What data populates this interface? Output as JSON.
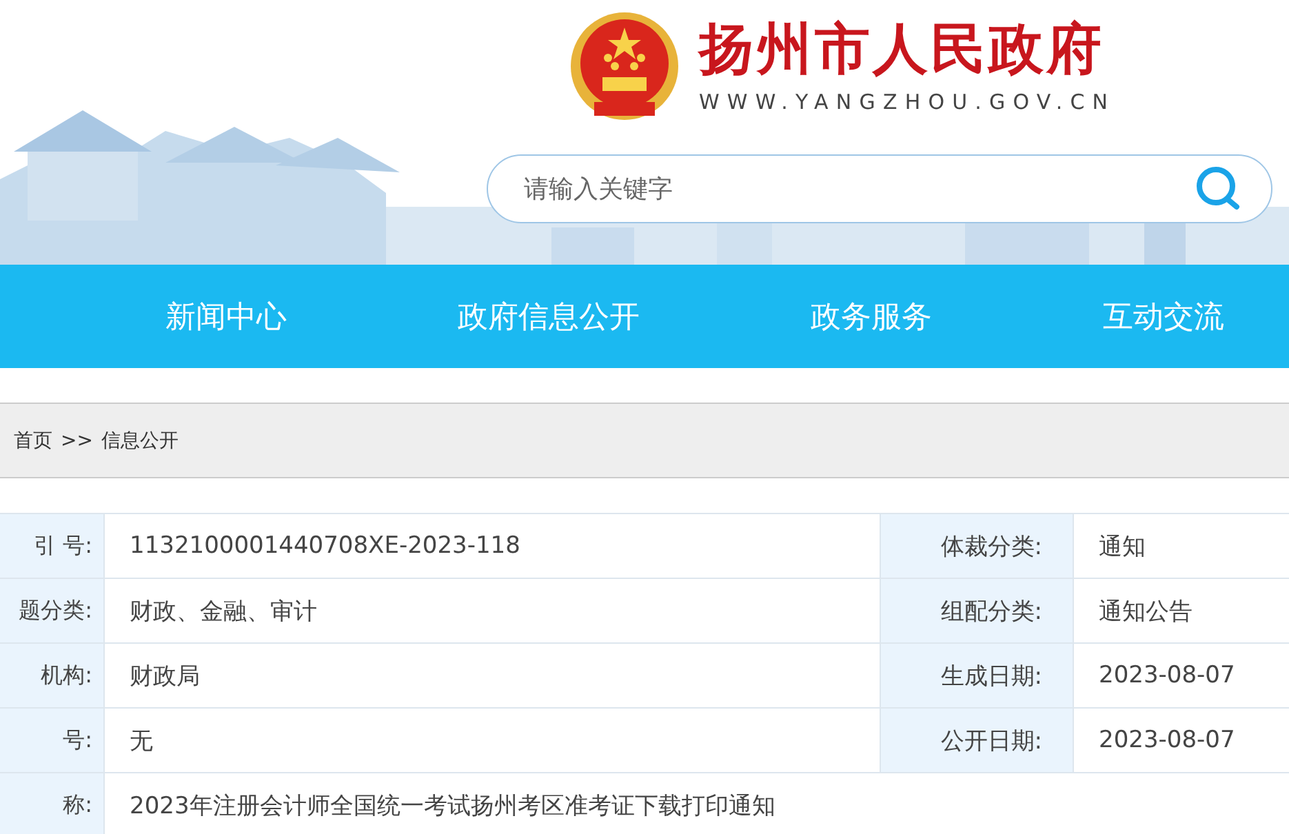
{
  "header": {
    "site_title": "扬州市人民政府",
    "site_url": "WWW.YANGZHOU.GOV.CN",
    "search": {
      "placeholder": "请输入关键字"
    }
  },
  "nav": [
    {
      "label": "新闻中心"
    },
    {
      "label": "政府信息公开"
    },
    {
      "label": "政务服务"
    },
    {
      "label": "互动交流"
    }
  ],
  "breadcrumb": [
    {
      "label": "首页"
    },
    {
      "label": ">>"
    },
    {
      "label": "信息公开"
    }
  ],
  "info_table": {
    "rows": [
      {
        "cells": [
          {
            "label": "引  号:",
            "value": "1132100001440708XE-2023-118"
          },
          {
            "label": "体裁分类:",
            "value": "通知"
          }
        ]
      },
      {
        "cells": [
          {
            "label": "题分类:",
            "value": "财政、金融、审计"
          },
          {
            "label": "组配分类:",
            "value": "通知公告"
          }
        ]
      },
      {
        "cells": [
          {
            "label": "机构:",
            "value": "财政局"
          },
          {
            "label": "生成日期:",
            "value": "2023-08-07"
          }
        ]
      },
      {
        "cells": [
          {
            "label": "号:",
            "value": "无"
          },
          {
            "label": "公开日期:",
            "value": "2023-08-07"
          }
        ]
      },
      {
        "cells": [
          {
            "label": "称:",
            "value": "2023年注册会计师全国统一考试扬州考区准考证下载打印通知"
          }
        ]
      }
    ]
  }
}
